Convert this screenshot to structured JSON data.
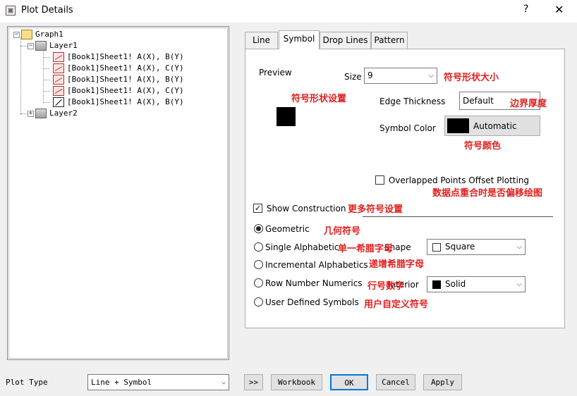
{
  "window": {
    "title": "Plot Details",
    "help_glyph": "?",
    "close_glyph": "✕"
  },
  "tree": {
    "root": "Graph1",
    "layer1": "Layer1",
    "plots": [
      "[Book1]Sheet1! A(X), B(Y)",
      "[Book1]Sheet1! A(X), C(Y)",
      "[Book1]Sheet1! A(X), B(Y)",
      "[Book1]Sheet1! A(X), C(Y)",
      "[Book1]Sheet1! A(X), B(Y)"
    ],
    "layer2": "Layer2",
    "expanded_glyph": "−",
    "collapsed_glyph": "+"
  },
  "tabs": [
    "Line",
    "Symbol",
    "Drop Lines",
    "Pattern"
  ],
  "active_tab": "Symbol",
  "symbol": {
    "preview_label": "Preview",
    "size_label": "Size",
    "size_value": "9",
    "edge_label": "Edge Thickness",
    "edge_value": "Default",
    "color_label": "Symbol Color",
    "color_button": "Automatic",
    "color_swatch": "#000000",
    "overlap_label": "Overlapped Points Offset Plotting",
    "show_construction_label": "Show Construction",
    "show_construction_checked": true,
    "radios": [
      {
        "label": "Geometric",
        "selected": true
      },
      {
        "label": "Single Alphabetic",
        "selected": false
      },
      {
        "label": "Incremental Alphabetics",
        "selected": false
      },
      {
        "label": "Row Number Numerics",
        "selected": false
      },
      {
        "label": "User Defined Symbols",
        "selected": false
      }
    ],
    "shape_label": "Shape",
    "shape_value": "Square",
    "interior_label": "Interior",
    "interior_value": "Solid"
  },
  "annotations": {
    "size": "符号形状大小",
    "shape_setting": "符号形状设置",
    "edge": "边界厚度",
    "color": "符号颜色",
    "overlap": "数据点重合时是否偏移绘图",
    "show_construction": "更多符号设置",
    "geometric": "几何符号",
    "single_alpha": "单一希腊字母",
    "incremental_alpha": "递增希腊字母",
    "row_number": "行号数字",
    "user_defined": "用户自定义符号"
  },
  "bottom": {
    "plot_type_label": "Plot Type",
    "plot_type_value": "Line + Symbol",
    "expand_button": ">>",
    "workbook_button": "Workbook",
    "ok_button": "OK",
    "cancel_button": "Cancel",
    "apply_button": "Apply"
  }
}
